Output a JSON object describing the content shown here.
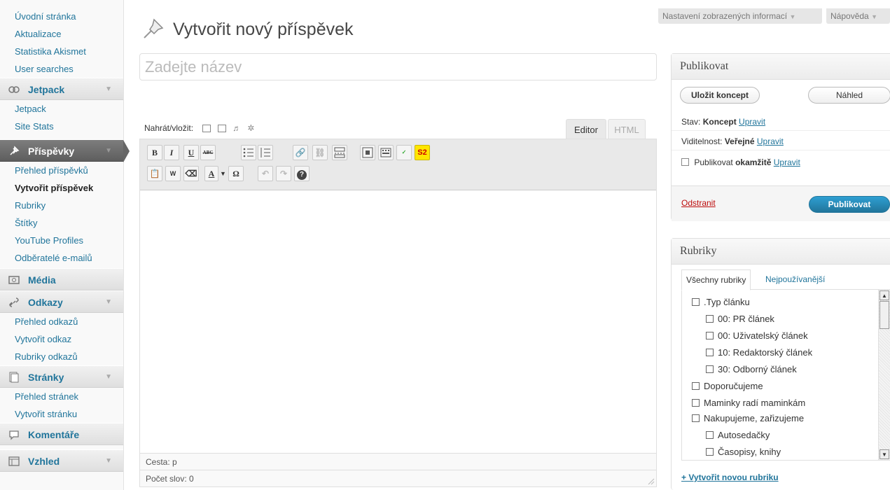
{
  "sidebar": {
    "top_items": [
      "Úvodní stránka",
      "Aktualizace",
      "Statistika Akismet",
      "User searches"
    ],
    "jetpack": {
      "label": "Jetpack",
      "items": [
        "Jetpack",
        "Site Stats"
      ]
    },
    "posts": {
      "label": "Příspěvky",
      "items": [
        "Přehled příspěvků",
        "Vytvořit příspěvek",
        "Rubriky",
        "Štítky",
        "YouTube Profiles",
        "Odběratelé e-mailů"
      ]
    },
    "media": {
      "label": "Média"
    },
    "links": {
      "label": "Odkazy",
      "items": [
        "Přehled odkazů",
        "Vytvořit odkaz",
        "Rubriky odkazů"
      ]
    },
    "pages": {
      "label": "Stránky",
      "items": [
        "Přehled stránek",
        "Vytvořit stránku"
      ]
    },
    "comments": {
      "label": "Komentáře"
    },
    "appearance": {
      "label": "Vzhled"
    }
  },
  "header": {
    "title": "Vytvořit nový příspěvek",
    "screen_options": "Nastavení zobrazených informací",
    "help": "Nápověda"
  },
  "editor": {
    "title_placeholder": "Zadejte název",
    "upload_label": "Nahrát/vložit:",
    "tab_editor": "Editor",
    "tab_html": "HTML",
    "path": "Cesta: p",
    "wordcount": "Počet slov: 0",
    "toolbar_row1": [
      "B",
      "I",
      "U",
      "ABC",
      "ul",
      "ol",
      "link",
      "unlink",
      "more",
      "fullscreen",
      "kitchen",
      "spell",
      "S2"
    ],
    "toolbar_row2": [
      "paste-text",
      "paste-word",
      "eraser",
      "A",
      "Ω",
      "undo",
      "redo",
      "?"
    ]
  },
  "publish": {
    "title": "Publikovat",
    "save_draft": "Uložit koncept",
    "preview": "Náhled",
    "status_label": "Stav:",
    "status_value": "Koncept",
    "visibility_label": "Viditelnost:",
    "visibility_value": "Veřejné",
    "publish_when_label": "Publikovat",
    "publish_when_value": "okamžitě",
    "edit": "Upravit",
    "trash": "Odstranit",
    "publish_button": "Publikovat"
  },
  "categories": {
    "title": "Rubriky",
    "tab_all": "Všechny rubriky",
    "tab_popular": "Nejpoužívanější",
    "list": [
      {
        "label": ".Typ článku",
        "level": 0
      },
      {
        "label": "00: PR článek",
        "level": 1
      },
      {
        "label": "00: Uživatelský článek",
        "level": 1
      },
      {
        "label": "10: Redaktorský článek",
        "level": 1
      },
      {
        "label": "30: Odborný článek",
        "level": 1
      },
      {
        "label": "Doporučujeme",
        "level": 0
      },
      {
        "label": "Maminky radí maminkám",
        "level": 0
      },
      {
        "label": "Nakupujeme, zařizujeme",
        "level": 0
      },
      {
        "label": "Autosedačky",
        "level": 1
      },
      {
        "label": "Časopisy, knihy",
        "level": 1
      }
    ],
    "add_new": "+ Vytvořit novou rubriku"
  },
  "colors": {
    "link": "#21759b",
    "primary_button": "#21759b",
    "trash": "#bc0b0b",
    "active_menu": "#6d6d6d"
  }
}
